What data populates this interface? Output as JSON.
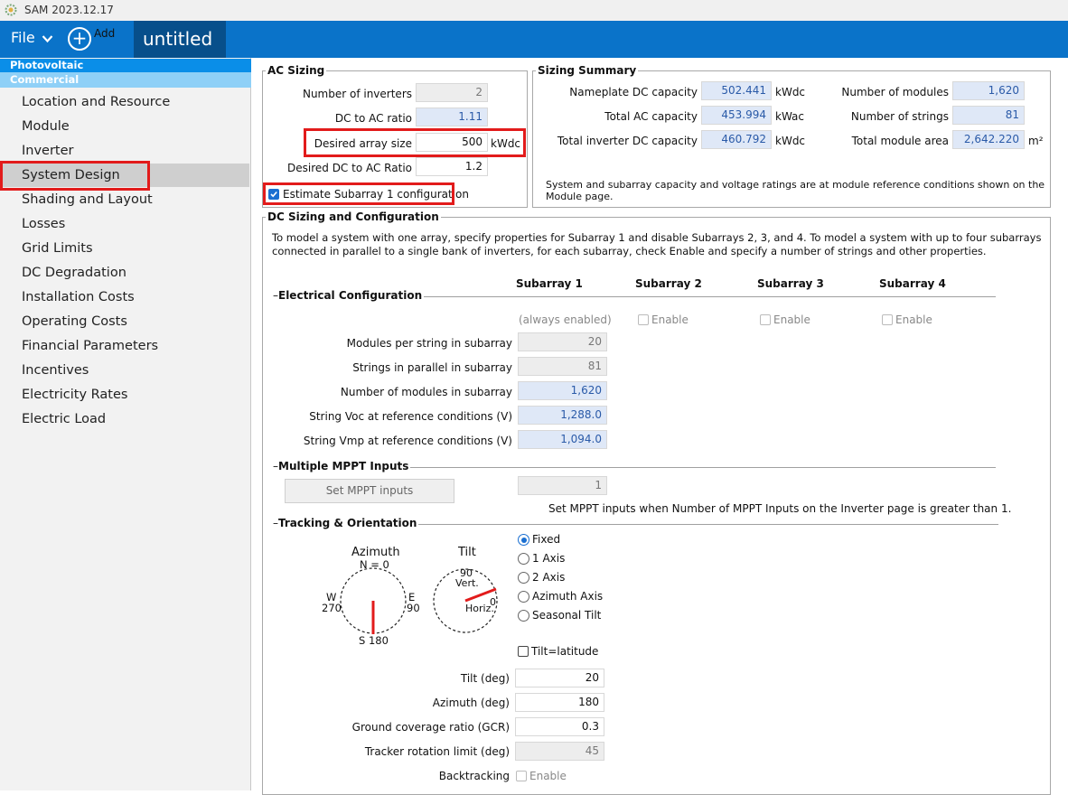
{
  "window": {
    "title": "SAM 2023.12.17"
  },
  "menubar": {
    "file": "File",
    "add": "Add",
    "case_tab": "untitled"
  },
  "sidebar": {
    "tech": "Photovoltaic",
    "fin": "Commercial",
    "items": [
      "Location and Resource",
      "Module",
      "Inverter",
      "System Design",
      "Shading and Layout",
      "Losses",
      "Grid Limits",
      "DC Degradation",
      "Installation Costs",
      "Operating Costs",
      "Financial Parameters",
      "Incentives",
      "Electricity Rates",
      "Electric Load"
    ],
    "selected": "System Design"
  },
  "ac_sizing": {
    "title": "AC Sizing",
    "num_inverters_label": "Number of inverters",
    "num_inverters": "2",
    "dc_ac_ratio_label": "DC to AC ratio",
    "dc_ac_ratio": "1.11",
    "desired_array_label": "Desired array size",
    "desired_array": "500",
    "desired_array_unit": "kWdc",
    "desired_ratio_label": "Desired DC to AC Ratio",
    "desired_ratio": "1.2",
    "estimate_label": "Estimate Subarray 1 configuration"
  },
  "sizing_summary": {
    "title": "Sizing Summary",
    "nameplate_label": "Nameplate DC capacity",
    "nameplate": "502.441",
    "nameplate_unit": "kWdc",
    "total_ac_label": "Total AC capacity",
    "total_ac": "453.994",
    "total_ac_unit": "kWac",
    "inv_dc_label": "Total inverter DC capacity",
    "inv_dc": "460.792",
    "inv_dc_unit": "kWdc",
    "num_modules_label": "Number of modules",
    "num_modules": "1,620",
    "num_strings_label": "Number of strings",
    "num_strings": "81",
    "module_area_label": "Total module area",
    "module_area": "2,642.220",
    "module_area_unit": "m²",
    "note1": "System and subarray capacity and voltage ratings are at module reference conditions shown on the",
    "note2": "Module page."
  },
  "dc_sizing": {
    "title": "DC Sizing and Configuration",
    "desc1": "To model a system with one array, specify properties for Subarray 1 and disable Subarrays 2, 3, and 4.  To model a system with up to four subarrays",
    "desc2": "connected in parallel to a single bank of inverters, for each subarray, check Enable and specify a number of strings and other properties.",
    "electrical_title": "Electrical Configuration",
    "sub_headers": [
      "Subarray 1",
      "Subarray 2",
      "Subarray 3",
      "Subarray 4"
    ],
    "always_enabled": "(always enabled)",
    "enable_label": "Enable",
    "modules_per_string_label": "Modules per string in subarray",
    "modules_per_string": "20",
    "strings_parallel_label": "Strings in parallel in subarray",
    "strings_parallel": "81",
    "num_modules_sub_label": "Number of modules in subarray",
    "num_modules_sub": "1,620",
    "voc_label": "String Voc at reference conditions (V)",
    "voc": "1,288.0",
    "vmp_label": "String Vmp at reference conditions (V)",
    "vmp": "1,094.0"
  },
  "mppt": {
    "title": "Multiple MPPT Inputs",
    "button": "Set MPPT inputs",
    "value": "1",
    "note": "Set MPPT inputs when Number of MPPT Inputs on the Inverter page is greater than 1."
  },
  "tracking": {
    "title": "Tracking & Orientation",
    "azimuth_title": "Azimuth",
    "az_n": "N = 0",
    "az_w": "W",
    "az_270": "270",
    "az_e": "E",
    "az_90": "90",
    "az_s": "S 180",
    "tilt_title": "Tilt",
    "tilt_90": "90",
    "tilt_vert": "Vert.",
    "tilt_0": "0",
    "tilt_horiz": "Horiz.",
    "options": [
      "Fixed",
      "1 Axis",
      "2 Axis",
      "Azimuth Axis",
      "Seasonal Tilt"
    ],
    "selected": "Fixed",
    "tilt_latitude": "Tilt=latitude",
    "tilt_label": "Tilt (deg)",
    "tilt": "20",
    "azimuth_label": "Azimuth (deg)",
    "azimuth": "180",
    "gcr_label": "Ground coverage ratio (GCR)",
    "gcr": "0.3",
    "rot_limit_label": "Tracker rotation limit (deg)",
    "rot_limit": "45",
    "backtracking_label": "Backtracking",
    "backtracking_enable": "Enable"
  }
}
